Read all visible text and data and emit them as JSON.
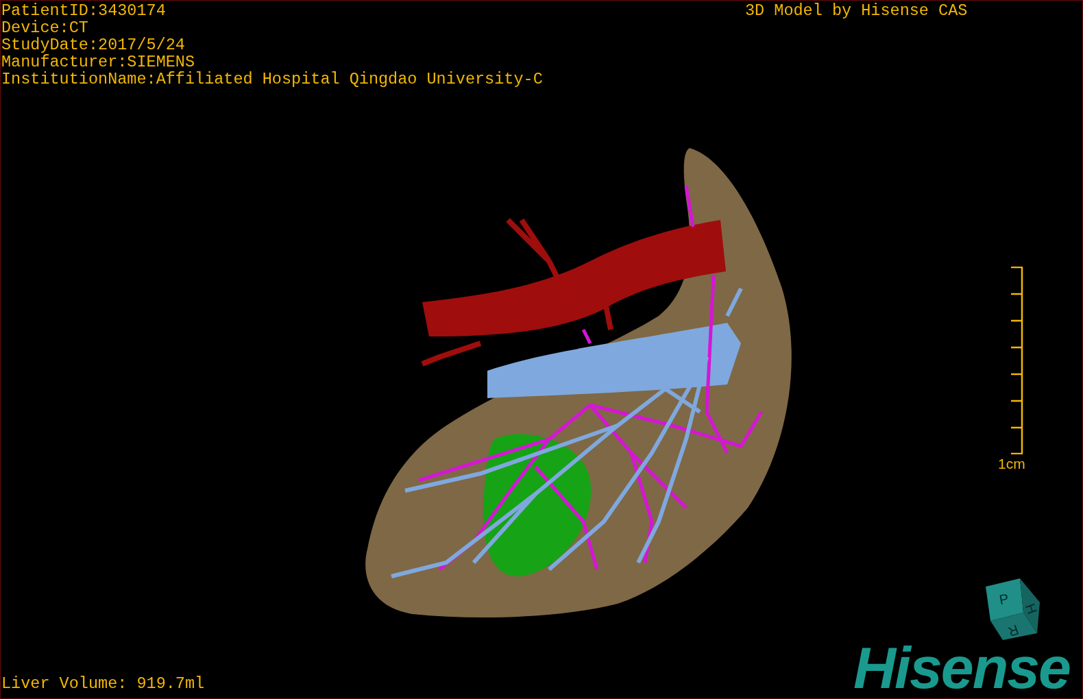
{
  "patient_info": [
    "PatientID:3430174",
    "Device:CT",
    "StudyDate:2017/5/24",
    "Manufacturer:SIEMENS",
    "InstitutionName:Affiliated Hospital Qingdao University-C"
  ],
  "title": "3D Model by Hisense CAS",
  "scale_bar": {
    "label": "1cm"
  },
  "orientation_cube": {
    "faces": [
      "P",
      "H",
      "R"
    ]
  },
  "logo": "Hisense",
  "liver_volume": "Liver Volume: 919.7ml"
}
